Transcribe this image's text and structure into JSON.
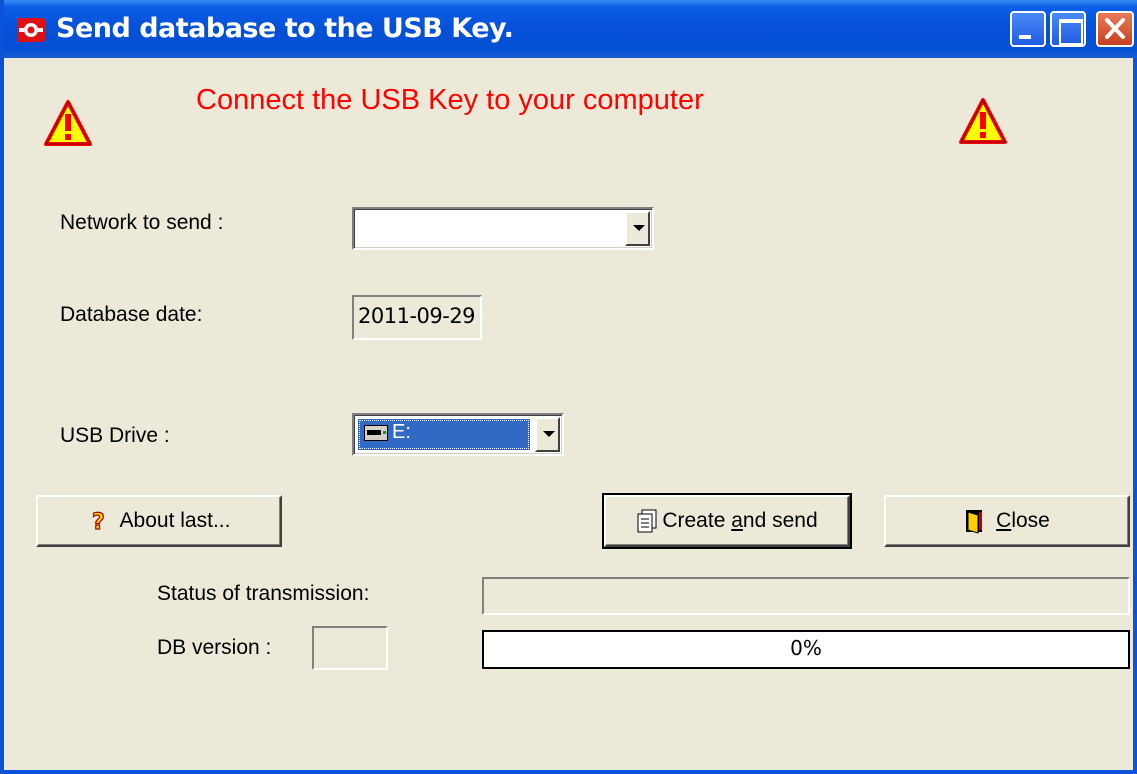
{
  "window": {
    "title": "Send database to the USB Key."
  },
  "header": {
    "message": "Connect the USB Key to your computer"
  },
  "form": {
    "network_label": "Network to send :",
    "network_value": "",
    "database_date_label": "Database date:",
    "database_date_value": "2011-09-29",
    "usb_drive_label": "USB Drive :",
    "usb_drive_value": "E:"
  },
  "buttons": {
    "about_last": "About last...",
    "create_and_send_prefix": "Create ",
    "create_and_send_accel": "a",
    "create_and_send_suffix": "nd send",
    "close_accel": "C",
    "close_suffix": "lose"
  },
  "status": {
    "transmission_label": "Status of transmission:",
    "transmission_value": "",
    "db_version_label": "DB version :",
    "db_version_value": "",
    "progress_text": "0%",
    "progress_fraction": 0
  },
  "colors": {
    "headline": "#FF0000",
    "titlebar": "#0550D6",
    "selection": "#316AC5",
    "dialog_bg": "#ECE9D8"
  },
  "icons": {
    "app": "app-logo-icon",
    "warning": "warning-triangle-icon",
    "drive": "removable-drive-icon",
    "help": "question-mark-icon",
    "send": "document-send-icon",
    "close": "exit-door-icon"
  }
}
